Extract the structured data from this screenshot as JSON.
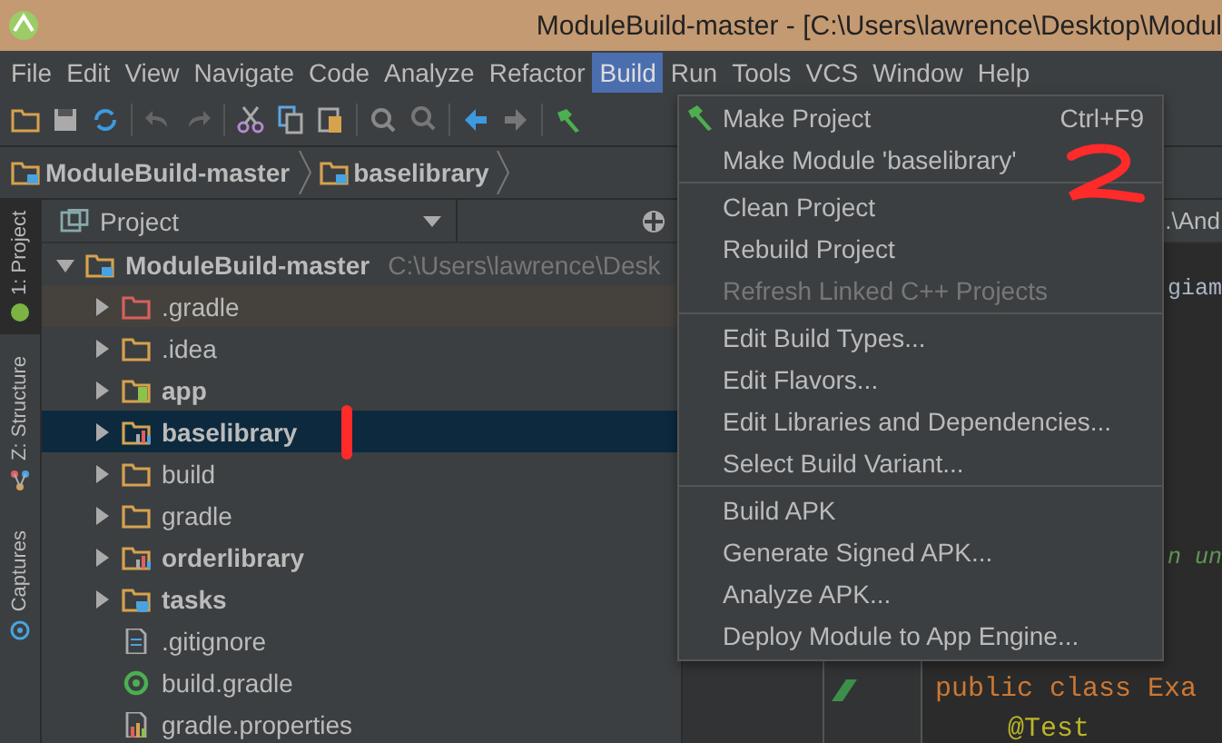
{
  "window": {
    "title": "ModuleBuild-master - [C:\\Users\\lawrence\\Desktop\\Modul"
  },
  "menubar": [
    {
      "label": "File",
      "selected": false
    },
    {
      "label": "Edit",
      "selected": false
    },
    {
      "label": "View",
      "selected": false
    },
    {
      "label": "Navigate",
      "selected": false
    },
    {
      "label": "Code",
      "selected": false
    },
    {
      "label": "Analyze",
      "selected": false
    },
    {
      "label": "Refactor",
      "selected": false
    },
    {
      "label": "Build",
      "selected": true
    },
    {
      "label": "Run",
      "selected": false
    },
    {
      "label": "Tools",
      "selected": false
    },
    {
      "label": "VCS",
      "selected": false
    },
    {
      "label": "Window",
      "selected": false
    },
    {
      "label": "Help",
      "selected": false
    }
  ],
  "breadcrumb": [
    "ModuleBuild-master",
    "baselibrary"
  ],
  "side_tabs": [
    {
      "label": "1: Project",
      "selected": true
    },
    {
      "label": "Z: Structure",
      "selected": false
    },
    {
      "label": "Captures",
      "selected": false
    }
  ],
  "project_panel": {
    "view": "Project",
    "tree": [
      {
        "name": "ModuleBuild-master",
        "path": "C:\\Users\\lawrence\\Desk",
        "kind": "project",
        "expanded": true,
        "selected": false,
        "children": [
          {
            "name": ".gradle",
            "kind": "excluded",
            "expanded": false,
            "selected": false
          },
          {
            "name": ".idea",
            "kind": "folder",
            "expanded": false,
            "selected": false
          },
          {
            "name": "app",
            "kind": "app",
            "expanded": false,
            "selected": false
          },
          {
            "name": "baselibrary",
            "kind": "library",
            "expanded": false,
            "selected": true
          },
          {
            "name": "build",
            "kind": "folder",
            "expanded": false,
            "selected": false
          },
          {
            "name": "gradle",
            "kind": "folder",
            "expanded": false,
            "selected": false
          },
          {
            "name": "orderlibrary",
            "kind": "library",
            "expanded": false,
            "selected": false
          },
          {
            "name": "tasks",
            "kind": "tasks",
            "expanded": false,
            "selected": false
          },
          {
            "name": ".gitignore",
            "kind": "file",
            "selected": false
          },
          {
            "name": "build.gradle",
            "kind": "gradle",
            "selected": false
          },
          {
            "name": "gradle.properties",
            "kind": "properties",
            "selected": false
          }
        ]
      }
    ]
  },
  "editor": {
    "tab": ".\\And",
    "lines": [
      {
        "text": "giam",
        "kind": "code"
      },
      {
        "text": "n un",
        "kind": "comment"
      },
      {
        "text": "public class Exa",
        "kind": "class"
      },
      {
        "text": "@Test",
        "kind": "annotation"
      }
    ]
  },
  "build_menu": [
    {
      "kind": "item",
      "label": "Make Project",
      "shortcut": "Ctrl+F9",
      "icon": true,
      "disabled": false
    },
    {
      "kind": "item",
      "label": "Make Module 'baselibrary'",
      "disabled": false
    },
    {
      "kind": "separator"
    },
    {
      "kind": "item",
      "label": "Clean Project",
      "disabled": false
    },
    {
      "kind": "item",
      "label": "Rebuild Project",
      "disabled": false
    },
    {
      "kind": "item",
      "label": "Refresh Linked C++ Projects",
      "disabled": true
    },
    {
      "kind": "separator"
    },
    {
      "kind": "item",
      "label": "Edit Build Types...",
      "disabled": false
    },
    {
      "kind": "item",
      "label": "Edit Flavors...",
      "disabled": false
    },
    {
      "kind": "item",
      "label": "Edit Libraries and Dependencies...",
      "disabled": false
    },
    {
      "kind": "item",
      "label": "Select Build Variant...",
      "disabled": false
    },
    {
      "kind": "separator"
    },
    {
      "kind": "item",
      "label": "Build APK",
      "disabled": false
    },
    {
      "kind": "item",
      "label": "Generate Signed APK...",
      "disabled": false
    },
    {
      "kind": "item",
      "label": "Analyze APK...",
      "disabled": false
    },
    {
      "kind": "item",
      "label": "Deploy Module to App Engine...",
      "disabled": false
    }
  ]
}
